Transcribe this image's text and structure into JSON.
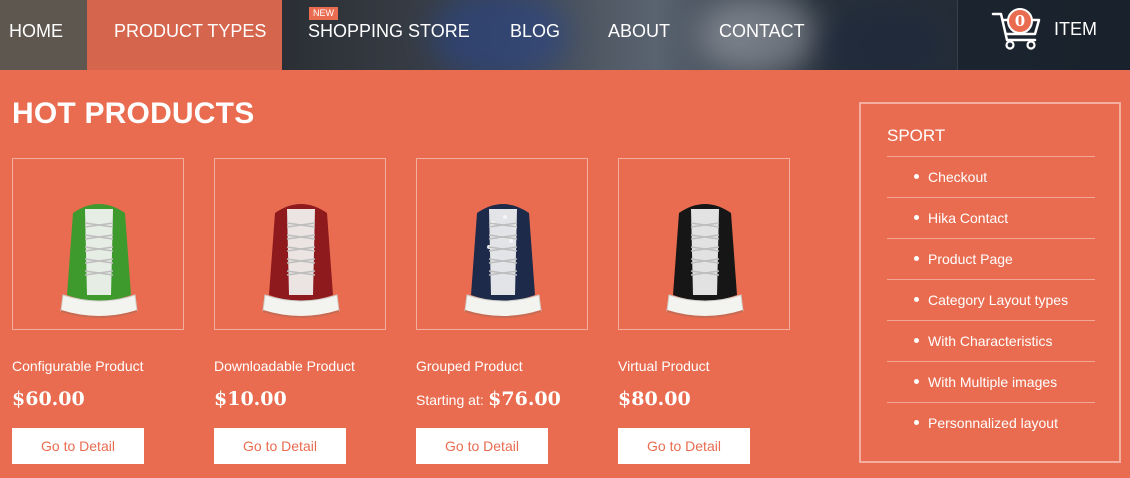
{
  "nav": {
    "items": [
      {
        "label": "HOME"
      },
      {
        "label": "PRODUCT TYPES"
      },
      {
        "label": "SHOPPING STORE",
        "badge": "NEW"
      },
      {
        "label": "BLOG"
      },
      {
        "label": "ABOUT"
      },
      {
        "label": "CONTACT"
      }
    ],
    "cart": {
      "count": "0",
      "label": "ITEM",
      "icon": "cart-icon"
    }
  },
  "main": {
    "title": "HOT PRODUCTS",
    "products": [
      {
        "name": "Configurable Product",
        "starting": "",
        "price": "$60.00",
        "button": "Go to Detail",
        "shoe_color": "#3f9a2e",
        "shoe_name": "green-sneaker"
      },
      {
        "name": "Downloadable Product",
        "starting": "",
        "price": "$10.00",
        "button": "Go to Detail",
        "shoe_color": "#8e1a1e",
        "shoe_name": "red-sneaker"
      },
      {
        "name": "Grouped Product",
        "starting": "Starting at:",
        "price": "$76.00",
        "button": "Go to Detail",
        "shoe_color": "#1d2a4a",
        "shoe_name": "stars-sneaker"
      },
      {
        "name": "Virtual Product",
        "starting": "",
        "price": "$80.00",
        "button": "Go to Detail",
        "shoe_color": "#161616",
        "shoe_name": "black-sneaker"
      }
    ]
  },
  "sidebar": {
    "title": "SPORT",
    "items": [
      {
        "label": "Checkout"
      },
      {
        "label": "Hika Contact"
      },
      {
        "label": "Product Page"
      },
      {
        "label": "Category Layout types"
      },
      {
        "label": "With Characteristics"
      },
      {
        "label": "With Multiple images"
      },
      {
        "label": "Personnalized layout"
      }
    ]
  },
  "colors": {
    "accent": "#e96c50",
    "nav_dark": "#2b2f35"
  }
}
